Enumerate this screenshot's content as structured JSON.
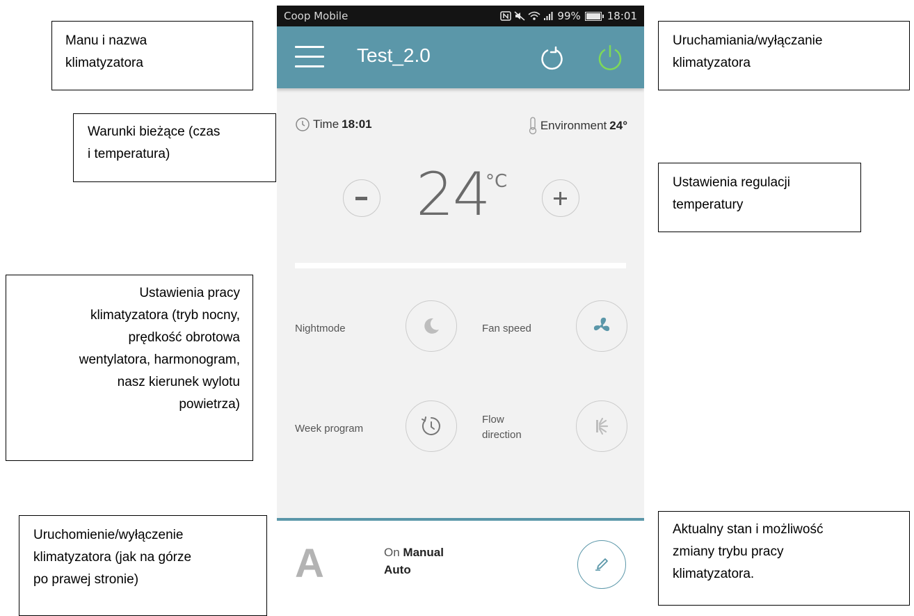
{
  "status_bar": {
    "carrier": "Coop Mobile",
    "battery": "99%",
    "time": "18:01"
  },
  "app_bar": {
    "title": "Test_2.0"
  },
  "conditions": {
    "time_label": "Time",
    "time_value": "18:01",
    "env_label": "Environment",
    "env_value": "24°"
  },
  "temperature": {
    "value": "24",
    "unit": "°C"
  },
  "options": [
    {
      "label": "Nightmode",
      "icon": "moon-icon"
    },
    {
      "label": "Fan speed",
      "icon": "fan-icon"
    },
    {
      "label": "Week program",
      "icon": "clock-icon"
    },
    {
      "label_line1": "Flow",
      "label_line2": "direction",
      "icon": "flow-direction-icon"
    }
  ],
  "mode": {
    "letter": "A",
    "state_prefix": "On",
    "state": "Manual",
    "sub": "Auto"
  },
  "callouts": {
    "menu_name": [
      "Manu i nazwa",
      "klimatyzatora"
    ],
    "power_top": [
      "Uruchamiania/wyłączanie",
      "klimatyzatora"
    ],
    "current_conditions": [
      "Warunki bieżące (czas",
      "i temperatura)"
    ],
    "temp_settings": [
      "Ustawienia regulacji",
      "temperatury"
    ],
    "operation_settings": [
      "Ustawienia pracy",
      "klimatyzatora (tryb nocny,",
      "prędkość obrotowa",
      "wentylatora, harmonogram,",
      "nasz kierunek wylotu",
      "powietrza)"
    ],
    "power_bottom": [
      "Uruchomienie/wyłączenie",
      "klimatyzatora (jak na górze",
      "po prawej stronie)"
    ],
    "mode_state": [
      "Aktualny stan i możliwość",
      "zmiany trybu pracy",
      "klimatyzatora."
    ]
  },
  "colors": {
    "appbar": "#5b97a9",
    "power": "#7ed957",
    "background": "#f2f2f2"
  }
}
